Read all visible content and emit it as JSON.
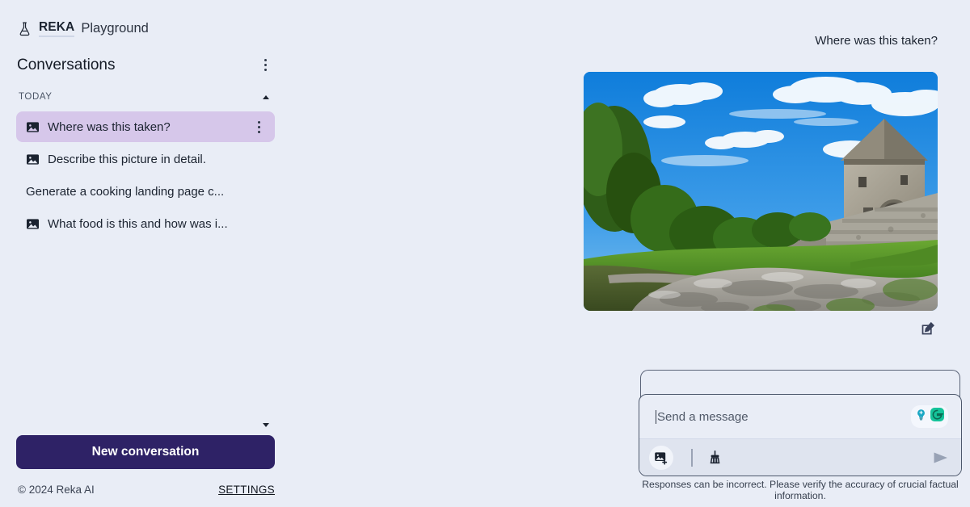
{
  "brand": {
    "icon": "flask-icon",
    "name": "REKA",
    "subtitle": "Playground"
  },
  "sidebar": {
    "conversations_title": "Conversations",
    "menu_icon": "kebab-menu-icon",
    "group_label": "TODAY",
    "collapse_up_icon": "caret-up-icon",
    "collapse_down_icon": "caret-down-icon",
    "items": [
      {
        "label": "Where was this taken?",
        "has_image": true,
        "selected": true
      },
      {
        "label": "Describe this picture in detail.",
        "has_image": true,
        "selected": false
      },
      {
        "label": "Generate a cooking landing page c...",
        "has_image": false,
        "selected": false
      },
      {
        "label": "What food is this and how was i...",
        "has_image": true,
        "selected": false
      }
    ],
    "new_conversation_label": "New conversation",
    "copyright": "© 2024 Reka AI",
    "settings_label": "SETTINGS"
  },
  "main": {
    "user_message": "Where was this taken?",
    "attachment_alt": "castle-photo",
    "edit_icon": "edit-square-icon"
  },
  "composer": {
    "placeholder": "Send a message",
    "value": "",
    "attach_image_icon": "add-image-icon",
    "clear_icon": "broom-icon",
    "send_icon": "send-icon",
    "grammarly_bulb_icon": "grammarly-bulb-icon",
    "grammarly_logo_icon": "grammarly-g-icon"
  },
  "disclaimer": "Responses can be incorrect. Please verify the accuracy of crucial factual information.",
  "colors": {
    "page_bg": "#e9edf6",
    "selected_item": "#d6c7ea",
    "primary_button": "#2e2266",
    "toolbar_bg": "#dfe4ef",
    "border": "#4d586c"
  }
}
